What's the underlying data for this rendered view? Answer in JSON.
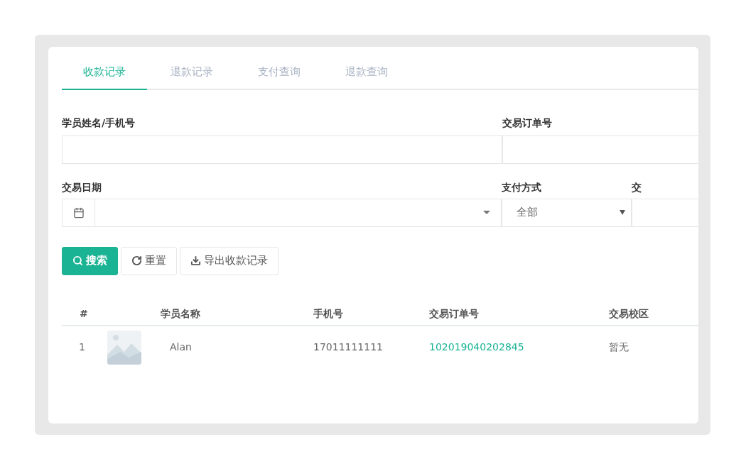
{
  "tabs": [
    {
      "label": "收款记录",
      "selected": true
    },
    {
      "label": "退款记录",
      "selected": false
    },
    {
      "label": "支付查询",
      "selected": false
    },
    {
      "label": "退款查询",
      "selected": false
    }
  ],
  "filters": {
    "student": {
      "label": "学员姓名/手机号"
    },
    "order_no": {
      "label": "交易订单号"
    },
    "date": {
      "label": "交易日期"
    },
    "pay_method": {
      "label": "支付方式",
      "value": "全部"
    },
    "column_3": {
      "label": "交"
    }
  },
  "buttons": [
    {
      "kind": "primary",
      "label": "搜索"
    },
    {
      "kind": "reset",
      "label": "重置"
    },
    {
      "kind": "export",
      "label": "导出收款记录"
    }
  ],
  "table": {
    "columns": [
      "#",
      "学员名称",
      "手机号",
      "交易订单号",
      "交易校区"
    ],
    "rows": [
      {
        "index": "1",
        "name": "Alan",
        "phone": "17011111111",
        "order_no": "102019040202845",
        "campus": "暂无"
      }
    ]
  }
}
